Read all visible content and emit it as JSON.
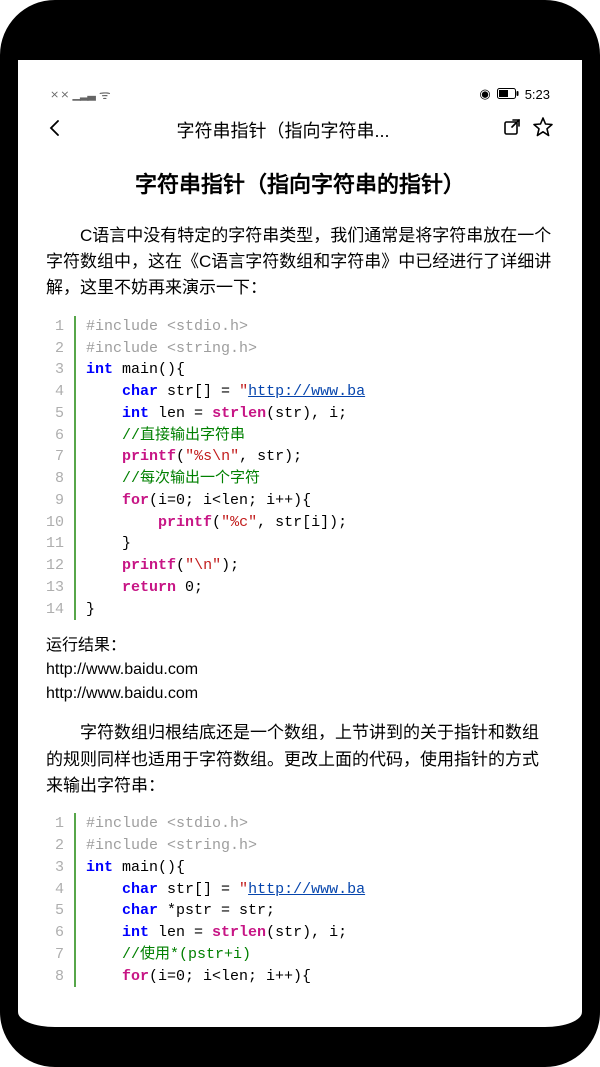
{
  "status": {
    "time": "5:23",
    "signal_left": "⨯ ⨯",
    "signal_bars": "▁▂▃",
    "wifi": "ᯤ"
  },
  "header": {
    "title": "字符串指针（指向字符串..."
  },
  "article": {
    "title": "字符串指针（指向字符串的指针）",
    "p1": "C语言中没有特定的字符串类型，我们通常是将字符串放在一个字符数组中，这在《C语言字符数组和字符串》中已经进行了详细讲解，这里不妨再来演示一下：",
    "result_label": "运行结果：",
    "result_line1": "http://www.baidu.com",
    "result_line2": "http://www.baidu.com",
    "p2": "字符数组归根结底还是一个数组，上节讲到的关于指针和数组的规则同样也适用于字符数组。更改上面的代码，使用指针的方式来输出字符串："
  },
  "code1": {
    "lines": [
      "1",
      "2",
      "3",
      "4",
      "5",
      "6",
      "7",
      "8",
      "9",
      "10",
      "11",
      "12",
      "13",
      "14"
    ],
    "l1": "#include <stdio.h>",
    "l2": "#include <string.h>",
    "l3_a": "int",
    "l3_b": " main(){",
    "l4_a": "    ",
    "l4_b": "char",
    "l4_c": " str[] = ",
    "l4_d": "\"",
    "l4_e": "http://www.ba",
    "l5_a": "    ",
    "l5_b": "int",
    "l5_c": " len = ",
    "l5_d": "strlen",
    "l5_e": "(str), i;",
    "l6_a": "    ",
    "l6_b": "//直接输出字符串",
    "l7_a": "    ",
    "l7_b": "printf",
    "l7_c": "(",
    "l7_d": "\"%s\\n\"",
    "l7_e": ", str);",
    "l8_a": "    ",
    "l8_b": "//每次输出一个字符",
    "l9_a": "    ",
    "l9_b": "for",
    "l9_c": "(i=0; i<len; i++){",
    "l10_a": "        ",
    "l10_b": "printf",
    "l10_c": "(",
    "l10_d": "\"%c\"",
    "l10_e": ", str[i]);",
    "l11": "    }",
    "l12_a": "    ",
    "l12_b": "printf",
    "l12_c": "(",
    "l12_d": "\"\\n\"",
    "l12_e": ");",
    "l13_a": "    ",
    "l13_b": "return",
    "l13_c": " 0;",
    "l14": "}"
  },
  "code2": {
    "lines": [
      "1",
      "2",
      "3",
      "4",
      "5",
      "6",
      "7",
      "8"
    ],
    "l1": "#include <stdio.h>",
    "l2": "#include <string.h>",
    "l3_a": "int",
    "l3_b": " main(){",
    "l4_a": "    ",
    "l4_b": "char",
    "l4_c": " str[] = ",
    "l4_d": "\"",
    "l4_e": "http://www.ba",
    "l5_a": "    ",
    "l5_b": "char",
    "l5_c": " *pstr = str;",
    "l6_a": "    ",
    "l6_b": "int",
    "l6_c": " len = ",
    "l6_d": "strlen",
    "l6_e": "(str), i;",
    "l7_a": "    ",
    "l7_b": "//使用*(pstr+i)",
    "l8_a": "    ",
    "l8_b": "for",
    "l8_c": "(i=0; i<len; i++){"
  }
}
